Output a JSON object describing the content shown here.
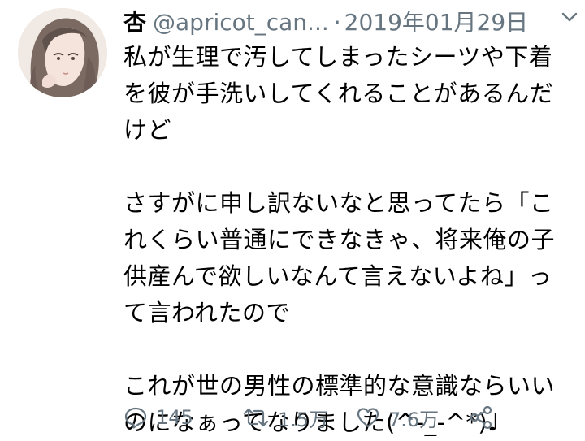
{
  "tweet": {
    "display_name": "杏",
    "handle": "@apricot_can...",
    "separator": "·",
    "date": "2019年01月29日",
    "paragraphs": [
      "私が生理で汚してしまったシーツや下着を彼が手洗いしてくれることがあるんだけど",
      "さすがに申し訳ないなと思ってたら「これくらい普通にできなきゃ、将来俺の子供産んで欲しいなんて言えないよね」って言われたので",
      "これが世の男性の標準的な意識ならいいのになぁってなりました(^-_-^*)♩"
    ]
  },
  "actions": {
    "replies": "145",
    "retweets": "1.5万",
    "likes": "7.6万"
  },
  "icons": {
    "menu": "chevron-down-icon",
    "reply": "reply-bubble-icon",
    "retweet": "retweet-icon",
    "like": "heart-icon",
    "share": "share-icon"
  },
  "colors": {
    "secondary_text": "#66757f",
    "primary_text": "#000000"
  }
}
